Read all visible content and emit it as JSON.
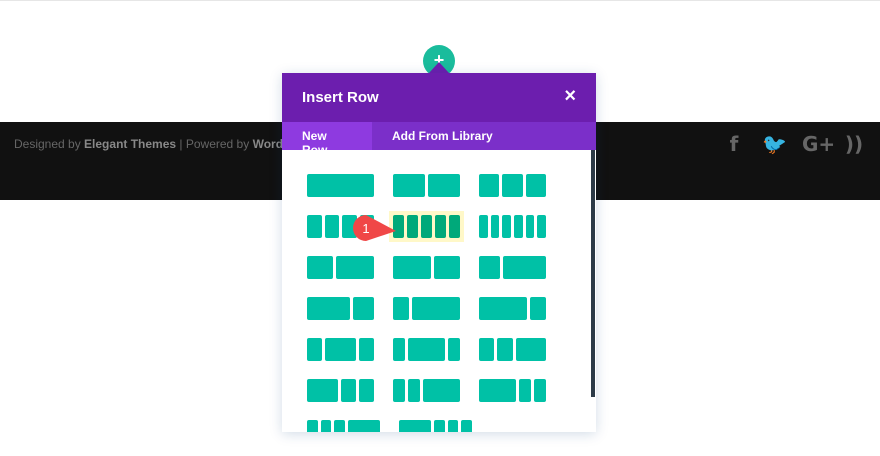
{
  "footer": {
    "prefix": "Designed by ",
    "brand": "Elegant Themes",
    "mid": " | Powered by ",
    "platform": "WordPress",
    "social": [
      {
        "icon": "facebook-icon",
        "glyph": "f"
      },
      {
        "icon": "twitter-icon",
        "glyph": "🐦"
      },
      {
        "icon": "google-plus-icon",
        "glyph": "G+"
      },
      {
        "icon": "rss-icon",
        "glyph": "))"
      }
    ]
  },
  "add_button": "+",
  "modal": {
    "title": "Insert Row",
    "close": "×",
    "tabs": [
      "New Row",
      "Add From Library"
    ]
  },
  "layouts": [
    [
      [
        1
      ],
      [
        1,
        1
      ],
      [
        1,
        1,
        1
      ]
    ],
    [
      [
        1,
        1,
        1,
        1
      ],
      [
        1,
        1,
        1,
        1,
        1
      ],
      [
        1,
        1,
        1,
        1,
        1,
        1
      ]
    ],
    [
      [
        2,
        3
      ],
      [
        3,
        2
      ],
      [
        1,
        2
      ]
    ],
    [
      [
        2,
        1
      ],
      [
        1,
        3
      ],
      [
        3,
        1
      ]
    ],
    [
      [
        1,
        2,
        1
      ],
      [
        1,
        3,
        1
      ],
      [
        1,
        1,
        2
      ]
    ],
    [
      [
        2,
        1,
        1
      ],
      [
        1,
        1,
        3
      ],
      [
        3,
        1,
        1
      ]
    ],
    [
      [
        1,
        1,
        1,
        3
      ],
      [
        3,
        1,
        1,
        1
      ]
    ]
  ],
  "highlighted": [
    1,
    1
  ],
  "marker": {
    "label": "1",
    "color": "#f04747"
  },
  "colors": {
    "accent": "#00c1a6",
    "header": "#6c1eae",
    "tab": "#8e3ae0"
  }
}
